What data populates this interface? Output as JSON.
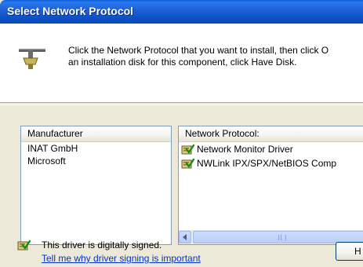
{
  "window": {
    "title": "Select Network Protocol"
  },
  "header": {
    "instructions_line1": "Click the Network Protocol that you want to install, then click O",
    "instructions_line2": "an installation disk for this component, click Have Disk.",
    "icon": "network-protocol-icon"
  },
  "manufacturer_list": {
    "header": "Manufacturer",
    "items": [
      "INAT GmbH",
      "Microsoft"
    ]
  },
  "protocol_list": {
    "header": "Network Protocol:",
    "items": [
      {
        "label": "Network Monitor Driver",
        "icon": "signed-driver-icon"
      },
      {
        "label": "NWLink IPX/SPX/NetBIOS Comp",
        "icon": "signed-driver-icon"
      }
    ]
  },
  "footer": {
    "signed_text": "This driver is digitally signed.",
    "signing_link": "Tell me why driver signing is important",
    "have_disk_label": "H"
  }
}
